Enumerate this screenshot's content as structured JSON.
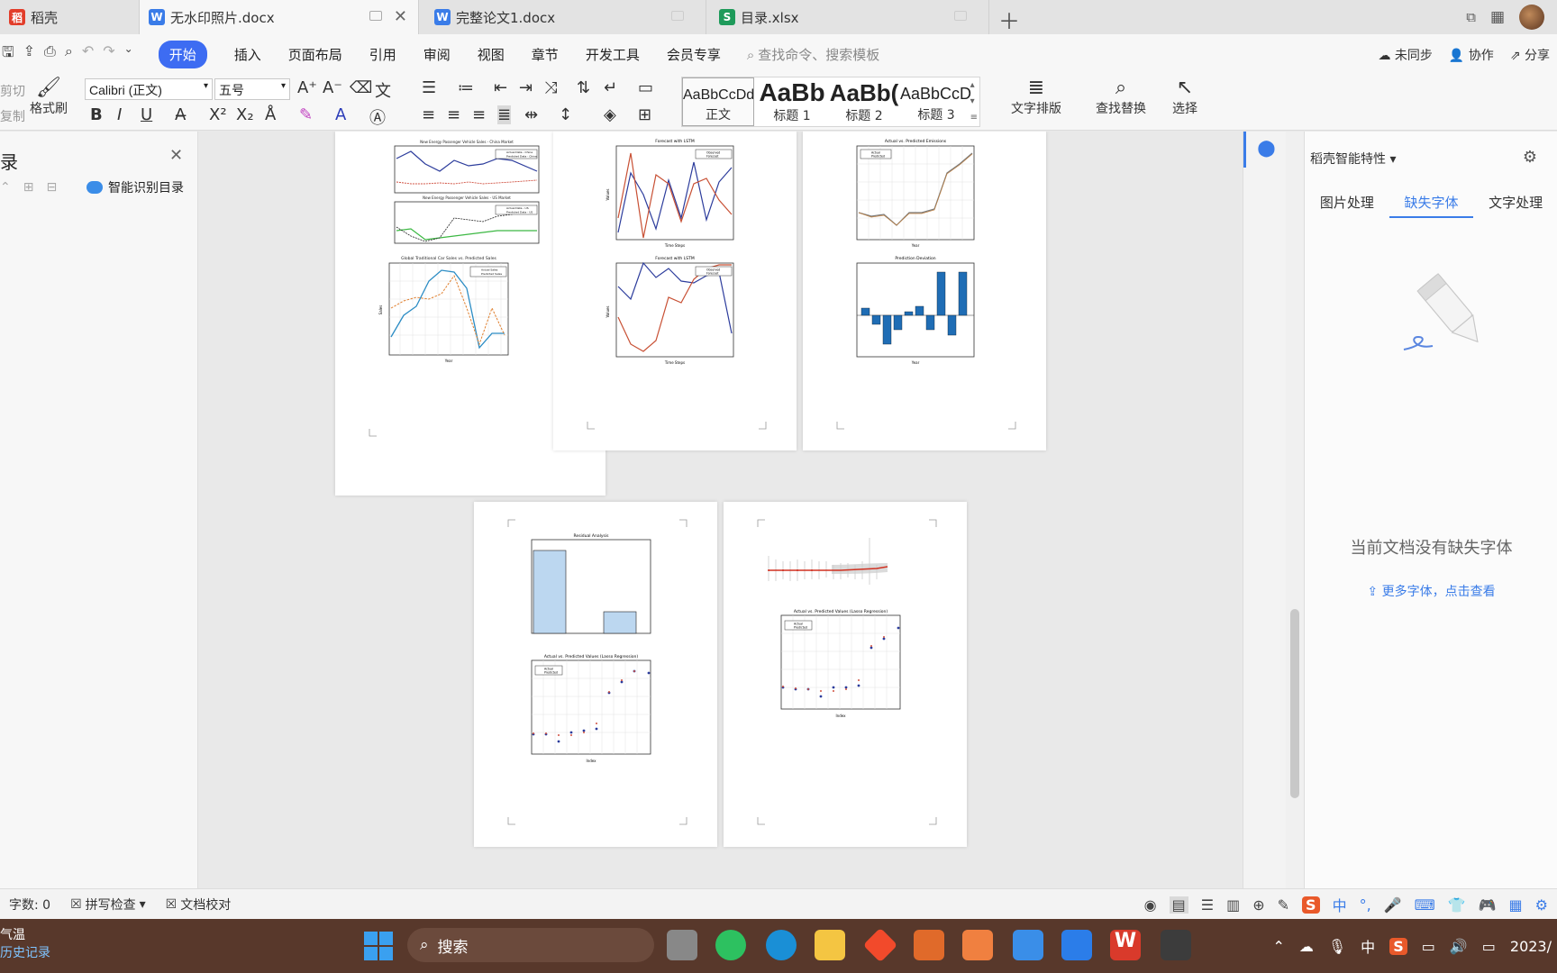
{
  "tabs": [
    {
      "label": "稻壳",
      "icon": "docer-icon",
      "color": "#e23d2a"
    },
    {
      "label": "无水印照片.docx",
      "icon": "word-doc-icon",
      "color": "#3a7ce8",
      "active": true
    },
    {
      "label": "完整论文1.docx",
      "icon": "word-doc-icon",
      "color": "#3a7ce8"
    },
    {
      "label": "目录.xlsx",
      "icon": "excel-icon",
      "color": "#1e9a5a"
    }
  ],
  "menu": {
    "items": [
      "开始",
      "插入",
      "页面布局",
      "引用",
      "审阅",
      "视图",
      "章节",
      "开发工具",
      "会员专享"
    ],
    "search_placeholder": "查找命令、搜索模板",
    "unsynced": "未同步",
    "collab": "协作",
    "share": "分享"
  },
  "ribbon": {
    "cut": "剪切",
    "copy": "复制",
    "format_painter": "格式刷",
    "font_name": "Calibri (正文)",
    "font_size": "五号",
    "styles": [
      {
        "sample": "AaBbCcDd",
        "name": "正文"
      },
      {
        "sample": "AaBb",
        "name": "标题 1"
      },
      {
        "sample": "AaBb(",
        "name": "标题 2"
      },
      {
        "sample": "AaBbCcDı",
        "name": "标题 3"
      }
    ],
    "text_layout": "文字排版",
    "find_replace": "查找替换",
    "select": "选择"
  },
  "nav": {
    "title": "录",
    "smart_dir": "智能识别目录"
  },
  "right_panel": {
    "title": "稻壳智能特性",
    "tabs": [
      "图片处理",
      "缺失字体",
      "文字处理"
    ],
    "active_tab": 1,
    "message": "当前文档没有缺失字体",
    "link": "更多字体，点击查看"
  },
  "statusbar": {
    "word_count": "字数: 0",
    "spell_check": "拼写检查",
    "doc_proof": "文档校对"
  },
  "taskbar": {
    "weather_line1": "气温",
    "weather_line2": "历史记录",
    "search": "搜索",
    "ime": "中",
    "clock": "2023/"
  },
  "charts": {
    "p1_top_title": "New Energy Passenger Vehicle Sales - China Market",
    "p1_top_legend": [
      "Actual Data - China",
      "Predicted Data - China"
    ],
    "p1_mid_title": "New Energy Passenger Vehicle Sales - US Market",
    "p1_mid_legend": [
      "Actual Data - US",
      "Predicted Data - US"
    ],
    "p1_bot_title": "Global Traditional Car Sales vs. Predicted Sales",
    "p1_bot_legend": [
      "Actual Sales",
      "Predicted Sales"
    ],
    "p1_bot_xlabel": "Year",
    "p1_bot_ylabel": "Sales",
    "p2_top_title": "Forecast with LSTM",
    "p2_bot_title": "Forecast with LSTM",
    "p2_legend": [
      "Observed",
      "Forecast"
    ],
    "p2_xlabel": "Time Steps",
    "p2_ylabel": "Values",
    "p3_top_title": "Actual vs. Predicted Emissions",
    "p3_top_legend": [
      "Actual",
      "Predicted"
    ],
    "p3_top_xlabel": "Year",
    "p3_bot_title": "Prediction Deviation",
    "p3_bot_xlabel": "Year",
    "p4_top_title": "Residual Analysis",
    "p4_bot_title": "Actual vs. Predicted Values (Lasso Regression)",
    "p4_bot_legend": [
      "Actual",
      "Predicted"
    ],
    "p4_bot_xlabel": "Index",
    "p5_bot_title": "Actual vs. Predicted Values (Lasso Regression)",
    "p5_bot_legend": [
      "Actual",
      "Predicted"
    ],
    "p5_bot_xlabel": "Index"
  }
}
